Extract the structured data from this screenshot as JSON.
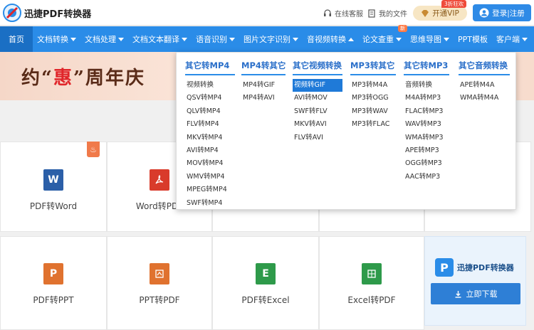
{
  "header": {
    "brand": "迅捷PDF转换器",
    "service_label": "在线客服",
    "files_label": "我的文件",
    "vip_label": "开通VIP",
    "vip_badge": "3折狂欢",
    "login_label": "登录|注册"
  },
  "nav": {
    "items": [
      {
        "label": "首页"
      },
      {
        "label": "文档转换"
      },
      {
        "label": "文档处理"
      },
      {
        "label": "文档文本翻译"
      },
      {
        "label": "语音识别"
      },
      {
        "label": "图片文字识别"
      },
      {
        "label": "音视频转换"
      },
      {
        "label": "论文查重"
      },
      {
        "label": "思维导图"
      },
      {
        "label": "PPT模板"
      },
      {
        "label": "客户端"
      }
    ],
    "new_badge": "新"
  },
  "banner": {
    "text_before": "约",
    "text_quote_open": "“",
    "text_highlight": "惠",
    "text_quote_close": "”",
    "text_after": "周年庆"
  },
  "dropdown": {
    "columns": [
      {
        "title": "其它转MP4",
        "items": [
          "视频转换",
          "QSV转MP4",
          "QLV转MP4",
          "FLV转MP4",
          "MKV转MP4",
          "AVI转MP4",
          "MOV转MP4",
          "WMV转MP4",
          "MPEG转MP4",
          "SWF转MP4"
        ]
      },
      {
        "title": "MP4转其它",
        "items": [
          "MP4转GIF",
          "MP4转AVI"
        ]
      },
      {
        "title": "其它视频转换",
        "items": [
          "视频转GIF",
          "AVI转MOV",
          "SWF转FLV",
          "MKV转AVI",
          "FLV转AVI"
        ]
      },
      {
        "title": "MP3转其它",
        "items": [
          "MP3转M4A",
          "MP3转OGG",
          "MP3转WAV",
          "MP3转FLAC"
        ]
      },
      {
        "title": "其它转MP3",
        "items": [
          "音频转换",
          "M4A转MP3",
          "FLAC转MP3",
          "WAV转MP3",
          "WMA转MP3",
          "APE转MP3",
          "OGG转MP3",
          "AAC转MP3"
        ]
      },
      {
        "title": "其它音频转换",
        "items": [
          "APE转M4A",
          "WMA转M4A"
        ]
      }
    ]
  },
  "cards": {
    "row1": [
      "PDF转Word",
      "Word转PDF"
    ],
    "row2": [
      "PDF转PPT",
      "PPT转PDF",
      "PDF转Excel",
      "Excel转PDF"
    ],
    "icons": {
      "word": "W",
      "ppt": "P",
      "excel": "E"
    }
  },
  "promo": {
    "name": "迅捷PDF转换器",
    "download_label": "立即下载"
  },
  "colors": {
    "nav": "#2a8ce8",
    "accent": "#2a6fc9",
    "active_item": "#1f7ad8",
    "word": "#2b5fa8",
    "pdf": "#d93b2b",
    "ppt": "#e0722f",
    "excel": "#2e9a4a"
  }
}
